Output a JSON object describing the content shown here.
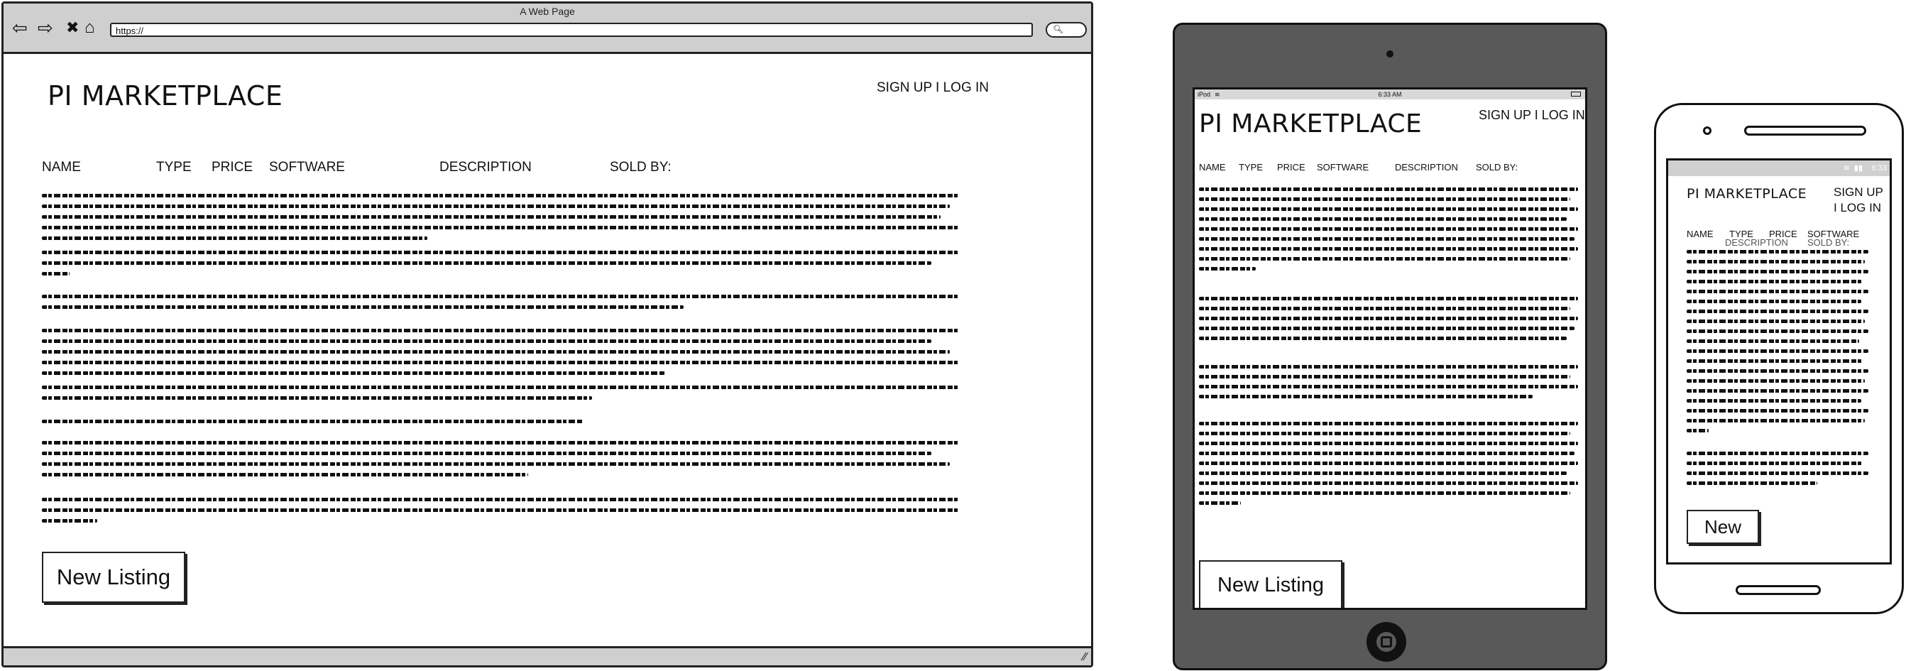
{
  "desktop": {
    "window_title": "A Web Page",
    "url": "https://",
    "site_title": "PI MARKETPLACE",
    "auth_link": "SIGN UP I LOG IN",
    "columns": [
      "NAME",
      "TYPE",
      "PRICE",
      "SOFTWARE",
      "DESCRIPTION",
      "SOLD BY:"
    ],
    "new_listing_label": "New Listing"
  },
  "tablet": {
    "status_carrier": "iPod",
    "status_time": "6:33 AM",
    "site_title": "PI MARKETPLACE",
    "auth_link": "SIGN UP I LOG IN",
    "columns": [
      "NAME",
      "TYPE",
      "PRICE",
      "SOFTWARE",
      "DESCRIPTION",
      "SOLD BY:"
    ],
    "new_listing_label": "New Listing"
  },
  "phone": {
    "status_time": "6:33",
    "site_title": "PI MARKETPLACE",
    "auth_line1": "SIGN UP",
    "auth_line2": "I LOG IN",
    "columns": [
      "NAME",
      "TYPE",
      "PRICE",
      "SOFTWARE",
      "DESCRIPTION",
      "SOLD BY:"
    ],
    "new_label": "New"
  },
  "icons": [
    "back-arrow-icon",
    "forward-arrow-icon",
    "stop-icon",
    "home-icon",
    "search-icon",
    "wifi-icon",
    "battery-icon",
    "signal-icon",
    "resize-grip-icon"
  ]
}
